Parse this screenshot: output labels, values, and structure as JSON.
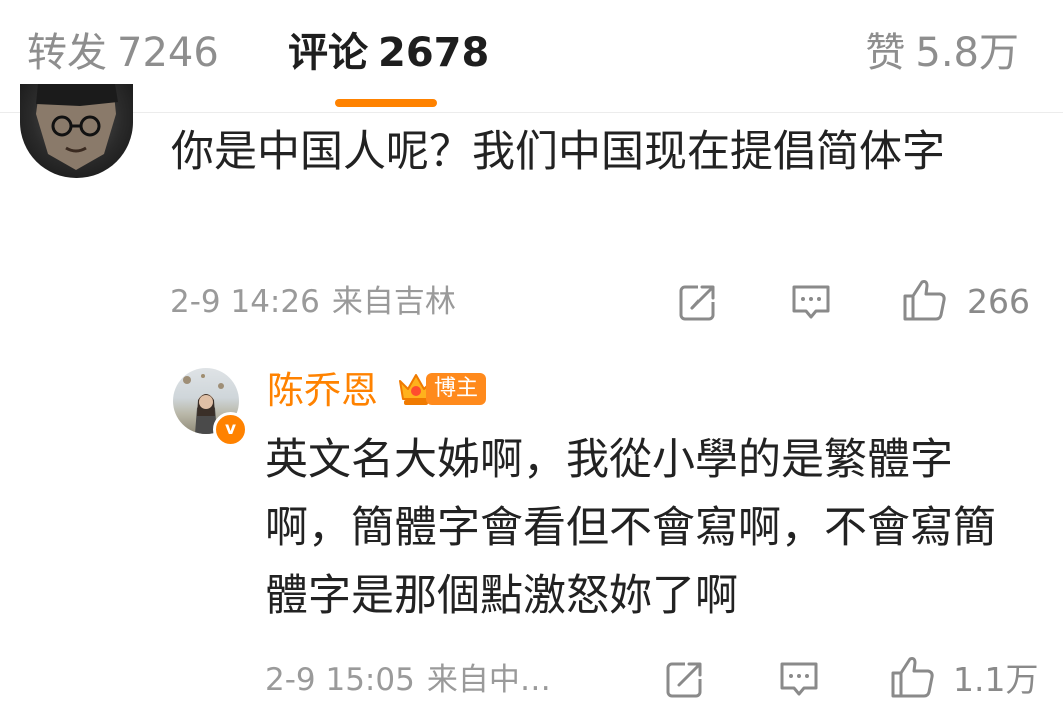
{
  "tabs": {
    "repost_label": "转发",
    "repost_count": "7246",
    "comment_label": "评论",
    "comment_count": "2678",
    "like_label": "赞",
    "like_count": "5.8万",
    "active": "comment",
    "accent": "#ff8200"
  },
  "comment": {
    "text": "你是中国人呢？我们中国现在提倡简体字",
    "time": "2-9 14:26",
    "location": "来自吉林",
    "like_count": "266",
    "icons": [
      "share-icon",
      "reply-icon",
      "thumbs-up-icon"
    ]
  },
  "reply": {
    "author": "陈乔恩",
    "badge": "博主",
    "verified_mark": "v",
    "text": "英文名大姊啊，我從小學的是繁體字啊，簡體字會看但不會寫啊，不會寫簡體字是那個點激怒妳了啊",
    "time": "2-9 15:05",
    "location": "来自中…",
    "like_count": "1.1万",
    "icons": [
      "share-icon",
      "reply-icon",
      "thumbs-up-icon"
    ]
  },
  "colors": {
    "name_orange": "#ff8200",
    "meta_gray": "#9a9a9a",
    "text_dark": "#222222"
  }
}
